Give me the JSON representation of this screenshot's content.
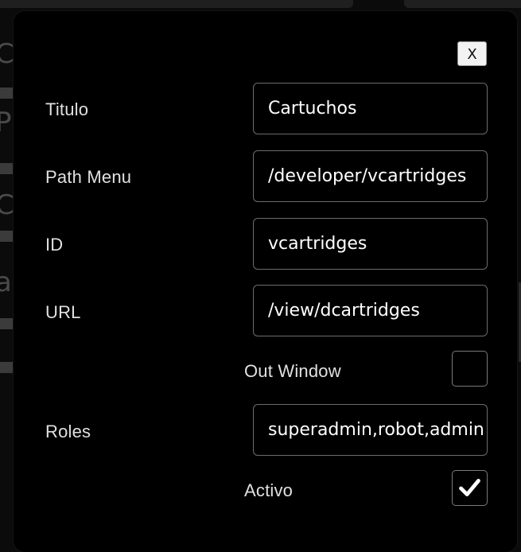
{
  "modal": {
    "close_label": "X",
    "fields": [
      {
        "label": "Titulo",
        "value": "Cartuchos"
      },
      {
        "label": "Path Menu",
        "value": "/developer/vcartridges"
      },
      {
        "label": "ID",
        "value": "vcartridges"
      },
      {
        "label": "URL",
        "value": "/view/dcartridges"
      }
    ],
    "out_window": {
      "label": "Out Window",
      "checked": false
    },
    "roles": {
      "label": "Roles",
      "value": "superadmin,robot,admin"
    },
    "activo": {
      "label": "Activo",
      "checked": true
    }
  },
  "background": {
    "glyphs": [
      "C",
      "P",
      "C",
      "a"
    ]
  },
  "colors": {
    "modal_bg": "#000000",
    "field_border": "#6c6c6c",
    "check_color": "#ffffff"
  }
}
